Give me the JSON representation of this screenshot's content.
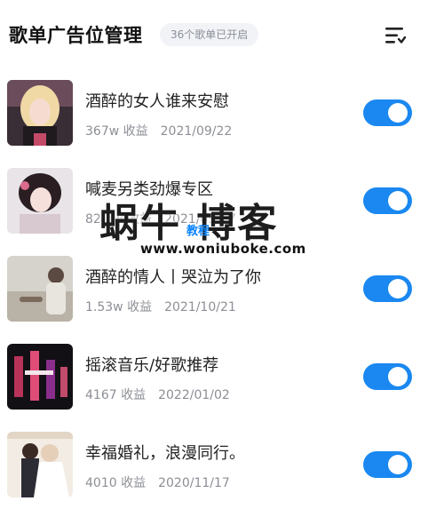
{
  "header": {
    "title": "歌单广告位管理",
    "count_badge": "36个歌单已开启",
    "sort_icon": "sort-list-icon"
  },
  "playlists": [
    {
      "title": "酒醉的女人谁来安慰",
      "earnings": "367w 收益",
      "date": "2021/09/22",
      "enabled": true
    },
    {
      "title": "喊麦另类劲爆专区",
      "earnings": "82.3w 收益",
      "date": "2021/09/17",
      "enabled": true
    },
    {
      "title": "酒醉的情人丨哭泣为了你",
      "earnings": "1.53w 收益",
      "date": "2021/10/21",
      "enabled": true
    },
    {
      "title": "摇滚音乐/好歌推荐",
      "earnings": "4167 收益",
      "date": "2022/01/02",
      "enabled": true
    },
    {
      "title": "幸福婚礼，浪漫同行。",
      "earnings": "4010 收益",
      "date": "2020/11/17",
      "enabled": true
    }
  ],
  "watermark": {
    "main": "蜗牛 博客",
    "sub": "教程",
    "url": "www.woniuboke.com"
  },
  "colors": {
    "toggle_on": "#1a88f0",
    "badge_bg": "#f2f3f7",
    "meta_text": "#8d8f96"
  }
}
